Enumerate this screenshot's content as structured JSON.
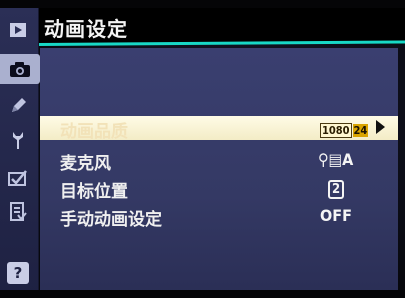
{
  "header": {
    "title": "动画设定"
  },
  "sidebar": {
    "tabs": [
      {
        "icon": "playback-icon",
        "active": false
      },
      {
        "icon": "camera-icon",
        "active": true
      },
      {
        "icon": "pencil-icon",
        "active": false
      },
      {
        "icon": "wrench-icon",
        "active": false
      },
      {
        "icon": "retouch-icon",
        "active": false
      },
      {
        "icon": "my-menu-icon",
        "active": false
      },
      {
        "icon": "help-icon",
        "active": false
      }
    ],
    "help_label": "?"
  },
  "menu": {
    "items": [
      {
        "label": "动画品质",
        "value_main": "1080",
        "value_badge": "24",
        "selected": true
      },
      {
        "label": "麦克风",
        "value": "⚲▤A",
        "selected": false
      },
      {
        "label": "目标位置",
        "value": "2",
        "selected": false
      },
      {
        "label": "手动动画设定",
        "value": "OFF",
        "selected": false
      }
    ]
  },
  "colors": {
    "accent_rule": "#18d8c6",
    "panel": "#3a3f70",
    "selected_row": "#fffbe6"
  }
}
